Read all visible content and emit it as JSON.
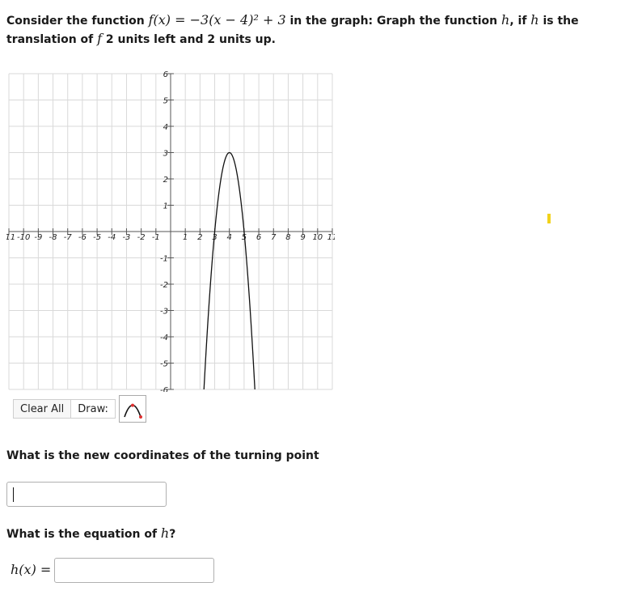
{
  "question": {
    "intro": "Consider the function",
    "function_math": "f(x) = −3(x − 4)² + 3",
    "mid": "in the graph: Graph the function",
    "h_var": "h",
    "mid2": ", if",
    "h_var2": "h",
    "mid3": "is the translation of",
    "f_var": "f",
    "end": "2 units left and 2 units up."
  },
  "graph": {
    "x_range": [
      -11,
      11
    ],
    "y_range": [
      -6,
      6
    ],
    "x_tick_labels": [
      "-11",
      "-10",
      "-9",
      "-8",
      "-7",
      "-6",
      "-5",
      "-4",
      "-3",
      "-2",
      "-1",
      "1",
      "2",
      "3",
      "4",
      "5",
      "6",
      "7",
      "8",
      "9",
      "10",
      "11"
    ],
    "y_tick_labels": [
      "6",
      "5",
      "4",
      "3",
      "2",
      "1",
      "-1",
      "-2",
      "-3",
      "-4",
      "-5",
      "-6"
    ],
    "curve": {
      "equation": "y = -3(x-4)^2 + 3",
      "vertex": [
        4,
        3
      ],
      "a": -3
    },
    "colors": {
      "grid": "#d9d9d9",
      "axis": "#555555",
      "curve": "#111111"
    }
  },
  "toolbar": {
    "clear_all_label": "Clear All",
    "draw_label": "Draw:",
    "tool_icon": "parabola-tool-icon"
  },
  "prompts": {
    "turning_point": "What is the new coordinates of the turning point",
    "equation_pre": "What is the equation of",
    "equation_var": "h",
    "equation_post": "?"
  },
  "answer": {
    "h_label": "h(x) =",
    "turning_point_value": "",
    "equation_value": ""
  }
}
